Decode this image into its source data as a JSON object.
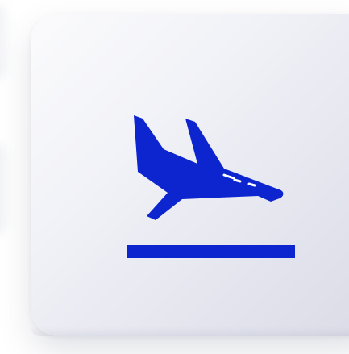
{
  "icon": {
    "name": "flight-land-icon",
    "color": "#0c25ce"
  }
}
